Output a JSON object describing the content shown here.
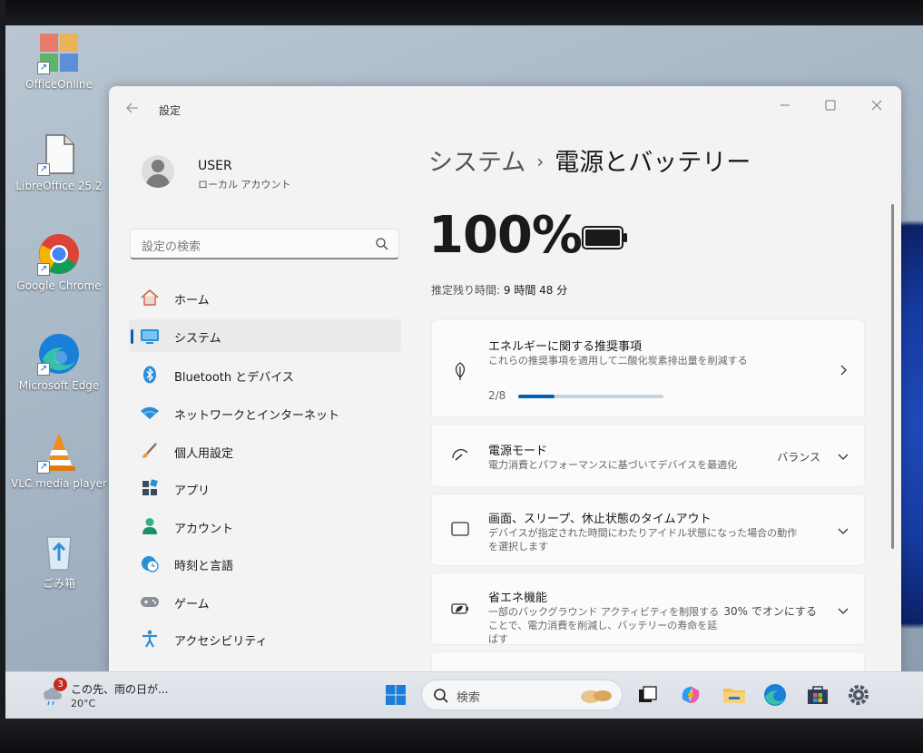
{
  "desktop": {
    "icons": [
      {
        "label": "OfficeOnline",
        "icon": "office-online-icon"
      },
      {
        "label": "LibreOffice 25.2",
        "icon": "libreoffice-icon"
      },
      {
        "label": "Google Chrome",
        "icon": "chrome-icon"
      },
      {
        "label": "Microsoft Edge",
        "icon": "edge-icon"
      },
      {
        "label": "VLC media player",
        "icon": "vlc-icon"
      },
      {
        "label": "ごみ箱",
        "icon": "recycle-bin-icon"
      }
    ]
  },
  "window": {
    "title": "設定",
    "controls": [
      "minimize",
      "maximize",
      "close"
    ]
  },
  "profile": {
    "name": "USER",
    "account_type": "ローカル アカウント"
  },
  "search": {
    "placeholder": "設定の検索"
  },
  "nav": {
    "items": [
      {
        "label": "ホーム",
        "icon": "home-icon",
        "active": false
      },
      {
        "label": "システム",
        "icon": "system-icon",
        "active": true
      },
      {
        "label": "Bluetooth とデバイス",
        "icon": "bluetooth-icon",
        "active": false
      },
      {
        "label": "ネットワークとインターネット",
        "icon": "wifi-icon",
        "active": false
      },
      {
        "label": "個人用設定",
        "icon": "brush-icon",
        "active": false
      },
      {
        "label": "アプリ",
        "icon": "apps-icon",
        "active": false
      },
      {
        "label": "アカウント",
        "icon": "account-icon",
        "active": false
      },
      {
        "label": "時刻と言語",
        "icon": "time-language-icon",
        "active": false
      },
      {
        "label": "ゲーム",
        "icon": "gamepad-icon",
        "active": false
      },
      {
        "label": "アクセシビリティ",
        "icon": "accessibility-icon",
        "active": false
      }
    ]
  },
  "main": {
    "breadcrumb_parent": "システム",
    "breadcrumb_separator": "›",
    "breadcrumb_current": "電源とバッテリー",
    "battery_percent": "100%",
    "battery_level": 1.0,
    "remaining_label": "推定残り時間:",
    "remaining_value": "9 時間 48 分",
    "cards": {
      "energy": {
        "title": "エネルギーに関する推奨事項",
        "desc": "これらの推奨事項を適用して二酸化炭素排出量を削減する",
        "progress_text": "2/8",
        "progress_fraction": 0.25
      },
      "power_mode": {
        "title": "電源モード",
        "desc": "電力消費とパフォーマンスに基づいてデバイスを最適化",
        "value": "バランス"
      },
      "timeout": {
        "title": "画面、スリープ、休止状態のタイムアウト",
        "desc": "デバイスが指定された時間にわたりアイドル状態になった場合の動作を選択します"
      },
      "saver": {
        "title": "省エネ機能",
        "desc": "一部のバックグラウンド アクティビティを制限することで、電力消費を削減し、バッテリーの寿命を延ばす",
        "value": "30% でオンにする"
      }
    }
  },
  "taskbar": {
    "weather_badge": "3",
    "weather_text": "この先、雨の日が...",
    "weather_temp": "20°C",
    "search_label": "検索",
    "apps": [
      "start-icon",
      "task-view-icon",
      "copilot-icon",
      "file-explorer-icon",
      "edge-icon",
      "store-icon",
      "settings-icon"
    ]
  },
  "colors": {
    "accent": "#005fb8",
    "window_bg": "#f3f3f3",
    "card_bg": "#fbfbfb"
  }
}
